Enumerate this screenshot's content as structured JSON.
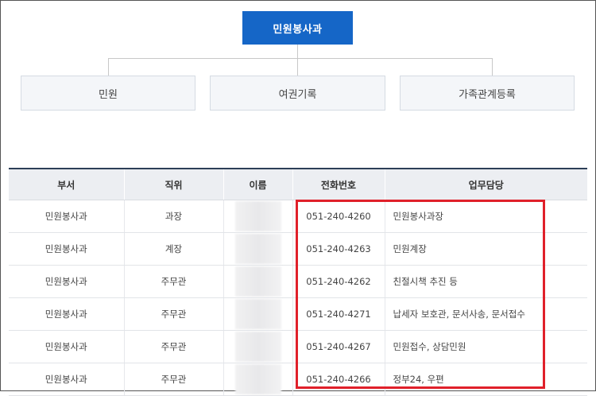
{
  "org_chart": {
    "top": "민원봉사과",
    "children": [
      "민원",
      "여권기록",
      "가족관계등록"
    ]
  },
  "table": {
    "headers": [
      "부서",
      "직위",
      "이름",
      "전화번호",
      "업무담당"
    ],
    "rows": [
      {
        "dept": "민원봉사과",
        "position": "과장",
        "name": "",
        "phone": "051-240-4260",
        "duty": "민원봉사과장"
      },
      {
        "dept": "민원봉사과",
        "position": "계장",
        "name": "",
        "phone": "051-240-4263",
        "duty": "민원계장"
      },
      {
        "dept": "민원봉사과",
        "position": "주무관",
        "name": "",
        "phone": "051-240-4262",
        "duty": "친절시책 추진 등"
      },
      {
        "dept": "민원봉사과",
        "position": "주무관",
        "name": "",
        "phone": "051-240-4271",
        "duty": "납세자 보호관, 문서사송, 문서접수"
      },
      {
        "dept": "민원봉사과",
        "position": "주무관",
        "name": "",
        "phone": "051-240-4267",
        "duty": "민원접수, 상담민원"
      },
      {
        "dept": "민원봉사과",
        "position": "주무관",
        "name": "",
        "phone": "051-240-4266",
        "duty": "정부24, 우편"
      }
    ]
  },
  "colors": {
    "top_box": "#1566c7",
    "highlight": "#e0202a",
    "header_bg": "#eceef2"
  }
}
